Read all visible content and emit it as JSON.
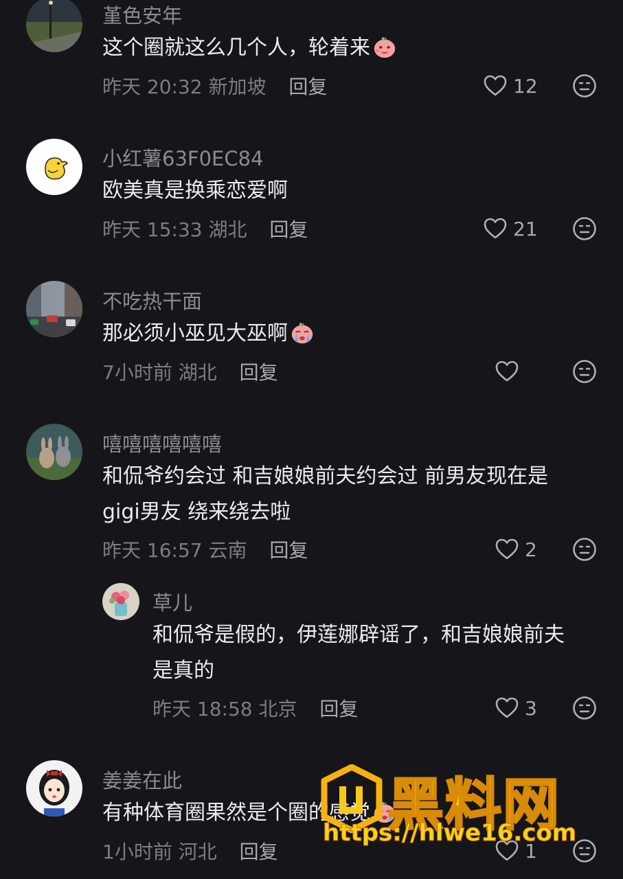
{
  "comments": [
    {
      "username": "堇色安年",
      "text": "这个圈就这么几个人，轮着来",
      "emoji": "laughing-peach-emoji",
      "time": "昨天 20:32",
      "location": "新加坡",
      "reply_label": "回复",
      "likes": "12"
    },
    {
      "username": "小红薯63F0EC84",
      "text": "欧美真是换乘恋爱啊",
      "time": "昨天 15:33",
      "location": "湖北",
      "reply_label": "回复",
      "likes": "21"
    },
    {
      "username": "不吃热干面",
      "text": "那必须小巫见大巫啊",
      "emoji": "crying-peach-emoji",
      "time": "7小时前",
      "location": "湖北",
      "reply_label": "回复",
      "likes": ""
    },
    {
      "username": "嘻嘻嘻嘻嘻嘻",
      "text_line1": "和侃爷约会过 和吉娘娘前夫约会过 前男友现在是",
      "text_line2": "gigi男友 绕来绕去啦",
      "time": "昨天 16:57",
      "location": "云南",
      "reply_label": "回复",
      "likes": "2"
    },
    {
      "username": "草儿",
      "text_line1": "和侃爷是假的，伊莲娜辟谣了，和吉娘娘前夫",
      "text_line2": "是真的",
      "time": "昨天 18:58",
      "location": "北京",
      "reply_label": "回复",
      "likes": "3"
    },
    {
      "username": "姜姜在此",
      "text": "有种体育圈果然是个圈的感觉",
      "emoji": "crying-peach-emoji",
      "time": "1小时前",
      "location": "河北",
      "reply_label": "回复",
      "likes": "1"
    }
  ],
  "watermark": {
    "title": "黑料网",
    "url": "https://hlwe16.com"
  },
  "colors": {
    "background": "#16161a",
    "text": "#ececef",
    "muted": "#7c7c82",
    "watermark": "#f7c919"
  }
}
